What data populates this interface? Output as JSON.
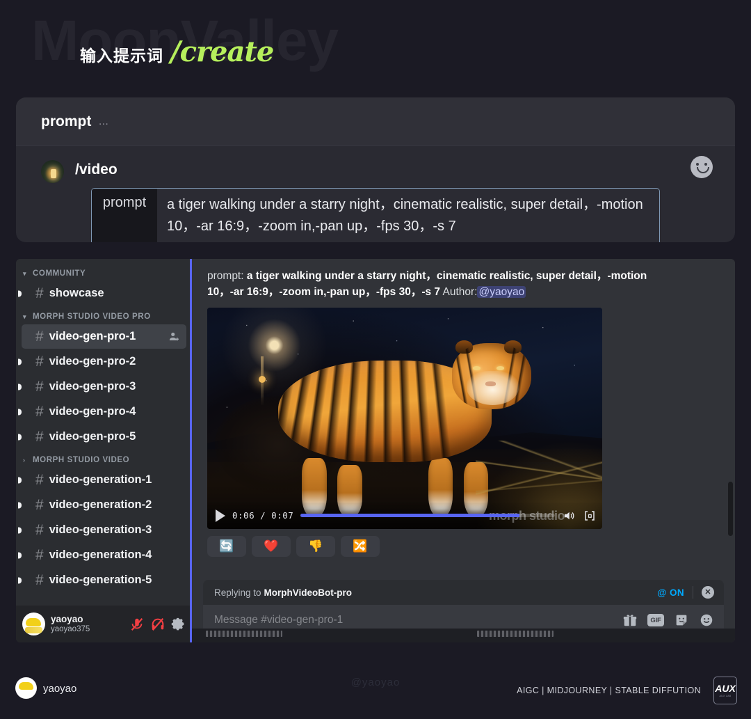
{
  "header": {
    "watermark_brand": "MoonValley",
    "instruction_cn": "输入提示词",
    "command": "/create"
  },
  "prompt_card": {
    "title": "prompt",
    "dots": "…",
    "command_label": "/video",
    "avatar_icon": "lantern-avatar",
    "emoji_icon": "smiley-icon",
    "input": {
      "chip_label": "prompt",
      "value": "a tiger walking under a starry night，cinematic realistic, super detail，-motion 10，-ar 16:9，-zoom in,-pan up，-fps 30，-s 7"
    }
  },
  "discord": {
    "sidebar": {
      "categories": [
        {
          "label": "COMMUNITY",
          "expanded": true,
          "chevron": "▾",
          "channels": [
            {
              "name": "showcase",
              "hash": "#",
              "unread": true,
              "active": false
            }
          ]
        },
        {
          "label": "MORPH STUDIO VIDEO PRO",
          "expanded": true,
          "chevron": "▾",
          "channels": [
            {
              "name": "video-gen-pro-1",
              "hash": "#",
              "unread": false,
              "active": true,
              "action_icon": "add-person-icon"
            },
            {
              "name": "video-gen-pro-2",
              "hash": "#",
              "unread": true,
              "active": false
            },
            {
              "name": "video-gen-pro-3",
              "hash": "#",
              "unread": true,
              "active": false
            },
            {
              "name": "video-gen-pro-4",
              "hash": "#",
              "unread": true,
              "active": false
            },
            {
              "name": "video-gen-pro-5",
              "hash": "#",
              "unread": true,
              "active": false
            }
          ]
        },
        {
          "label": "MORPH STUDIO VIDEO",
          "expanded": false,
          "chevron": "›",
          "channels": [
            {
              "name": "video-generation-1",
              "hash": "#",
              "unread": true,
              "active": false
            },
            {
              "name": "video-generation-2",
              "hash": "#",
              "unread": true,
              "active": false
            },
            {
              "name": "video-generation-3",
              "hash": "#",
              "unread": true,
              "active": false
            },
            {
              "name": "video-generation-4",
              "hash": "#",
              "unread": true,
              "active": false
            },
            {
              "name": "video-generation-5",
              "hash": "#",
              "unread": true,
              "active": false
            }
          ]
        }
      ],
      "user_panel": {
        "display_name": "yaoyao",
        "username": "yaoyao375",
        "icons": [
          "mic-muted-icon",
          "headphone-deafened-icon",
          "gear-icon"
        ]
      }
    },
    "message": {
      "prefix": "prompt:",
      "body_bold": "a tiger walking under a starry night，cinematic realistic, super detail，-motion 10，-ar 16:9，-zoom in,-pan up，-fps 30，-s 7",
      "author_label": "Author:",
      "author_mention": "@yaoyao"
    },
    "video": {
      "current_time": "0:06",
      "duration": "0:07",
      "time_display": "0:06 / 0:07",
      "progress_percent": 86,
      "watermark": "morph studio",
      "play_icon": "play-icon",
      "volume_icon": "volume-icon",
      "fullscreen_icon": "picture-in-picture-icon",
      "alt": "a tiger walking under a starry night"
    },
    "reactions": [
      {
        "name": "repeat-reaction",
        "glyph": "🔄"
      },
      {
        "name": "heart-reaction",
        "glyph": "❤️"
      },
      {
        "name": "thumbsdown-reaction",
        "glyph": "👎"
      },
      {
        "name": "shuffle-reaction",
        "glyph": "🔀"
      }
    ],
    "reply_bar": {
      "prefix": "Replying to",
      "target": "MorphVideoBot-pro",
      "mention_toggle": "@ ON",
      "close_icon": "close-icon"
    },
    "composer": {
      "placeholder": "Message #video-gen-pro-1",
      "icons": [
        "gift-icon",
        "gif-icon",
        "sticker-icon",
        "emoji-icon"
      ],
      "gif_label": "GIF"
    }
  },
  "footer": {
    "avatar_icon": "yaoyao-avatar",
    "name": "yaoyao",
    "watermark": "@yaoyao",
    "tags": "AIGC | MIDJOURNEY | STABLE DIFFUTION",
    "logo": {
      "big": "AUX",
      "small": "AUX LAB"
    }
  },
  "colors": {
    "page_bg": "#1b1a24",
    "accent_green": "#b6f05c",
    "discord_blurple": "#5865f2",
    "link_blue": "#00a8fc"
  }
}
